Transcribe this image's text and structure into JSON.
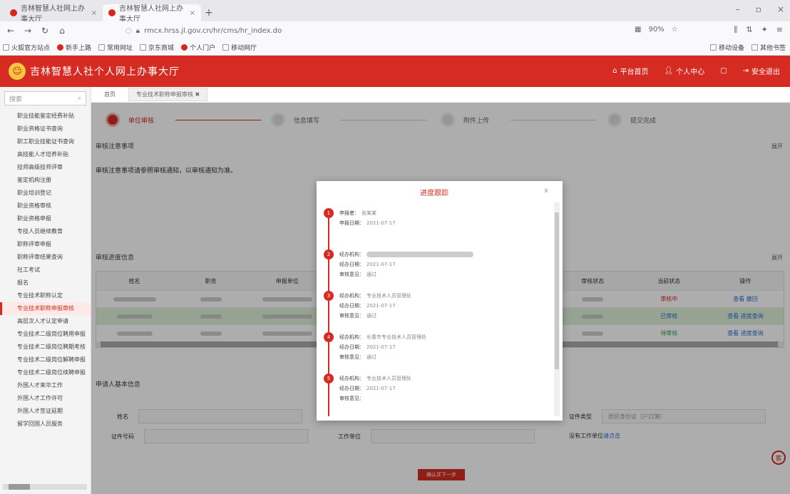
{
  "browser": {
    "tabs": [
      {
        "label": "吉林智慧人社网上办事大厅",
        "active": false
      },
      {
        "label": "吉林智慧人社网上办事大厅",
        "active": true
      }
    ],
    "new_tab": "+",
    "url": "rmcx.hrss.jl.gov.cn/hr/cms/hr_index.do",
    "zoom": "90%",
    "bookmarks": [
      "火狐官方站点",
      "新手上路",
      "常用网址",
      "京东商城",
      "个人门户",
      "移动网厅"
    ],
    "bookmarks_right": [
      "移动设备",
      "其他书签"
    ]
  },
  "header": {
    "logo_glyph": "☺",
    "title": "吉林智慧人社个人网上办事大厅",
    "home": "平台首页",
    "user": "个人中心",
    "logout": "安全退出"
  },
  "sidebar": {
    "search_placeholder": "搜索",
    "items": [
      "职业技能鉴定经费补贴",
      "职业资格证书查询",
      "职工职业技能证书查询",
      "高技能人才培养补贴",
      "技师高级技师评审",
      "鉴定机构注册",
      "职业培训登记",
      "职业资格审核",
      "职业资格申报",
      "专技人员继续教育",
      "职称评审申报",
      "职称评审结果查询",
      "社工考试",
      "报名",
      "专业技术职称认定",
      "专业技术职称申报审核",
      "高层次人才认定申请",
      "专业技术二级岗位聘用申报",
      "专业技术二级岗位聘期考核",
      "专业技术二级岗位解聘申报",
      "专业技术二级岗位续聘申报",
      "外国人才来华工作",
      "外国人才工作许可",
      "外国人才签证延期",
      "留学回国人员服务"
    ],
    "active_index": 15
  },
  "main": {
    "breadcrumb_home": "首页",
    "breadcrumb_tab": "专业技术职称申报审核 ✖",
    "steps": [
      "单位审核",
      "信息填写",
      "附件上传",
      "提交完成"
    ],
    "section1_title": "审核注意事项",
    "section1_toggle": "展开",
    "notice": "审核注意事项请参照审核通知，以审核通知为准。",
    "section2_title": "审核进度信息",
    "section2_toggle": "展开",
    "table_headers": [
      "姓名",
      "职务",
      "申报单位",
      "",
      "",
      "",
      "审核状态",
      "当前状态",
      "操作"
    ],
    "rows": [
      {
        "status": "审核中",
        "ops": "查看  撤回"
      },
      {
        "status": "已审核",
        "ops": "查看  进度查询"
      },
      {
        "status": "待审核",
        "ops": "查看  进度查询"
      }
    ],
    "section3_title": "申请人基本信息",
    "form": {
      "name_label": "姓名",
      "cert_label": "证件类型",
      "cert_value": "居民身份证（户口簿）",
      "id_label": "证件号码",
      "unit_label": "工作单位",
      "no_unit_label": "没有工作单位",
      "no_unit_link": "请点击"
    },
    "submit": "确认并下一步",
    "float_glyph": "客"
  },
  "modal": {
    "title": "进度跟踪",
    "close": "x",
    "items": [
      {
        "no": "1",
        "lines": [
          [
            "申报者",
            "张某某"
          ],
          [
            "申报日期",
            "2021-07-17"
          ]
        ]
      },
      {
        "no": "2",
        "lines": [
          [
            "经办机构",
            ""
          ],
          [
            "经办日期",
            "2021-07-17"
          ],
          [
            "审核意见",
            "通过"
          ]
        ]
      },
      {
        "no": "3",
        "lines": [
          [
            "经办机构",
            "专业技术人员管理处"
          ],
          [
            "经办日期",
            "2021-07-17"
          ],
          [
            "审核意见",
            "通过"
          ]
        ]
      },
      {
        "no": "4",
        "lines": [
          [
            "经办机构",
            "长春市专业技术人员管理处"
          ],
          [
            "经办日期",
            "2021-07-17"
          ],
          [
            "审核意见",
            "通过"
          ]
        ]
      },
      {
        "no": "5",
        "lines": [
          [
            "经办机构",
            "专业技术人员管理处"
          ],
          [
            "经办日期",
            "2021-07-17"
          ],
          [
            "审核意见",
            ""
          ]
        ]
      }
    ]
  }
}
